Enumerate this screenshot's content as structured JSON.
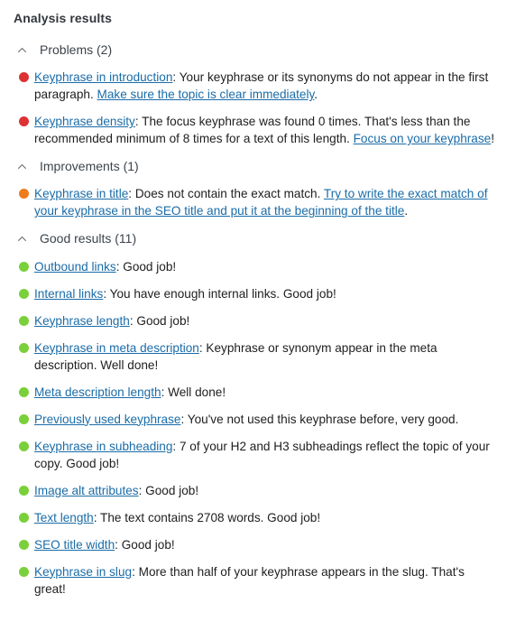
{
  "panel": {
    "title": "Analysis results"
  },
  "colors": {
    "problem": "#dc3232",
    "improvement": "#ee7c1b",
    "good": "#7ad03a",
    "link": "#1a6ca8",
    "heading": "#32373c",
    "section_heading": "#3c434a",
    "body_text": "#1e1e1e",
    "background": "#ffffff"
  },
  "icons": {
    "collapse": "chevron-up-icon"
  },
  "sections": [
    {
      "id": "problems",
      "title": "Problems (2)",
      "count": 2,
      "expanded": true,
      "bullet_color": "#dc3232",
      "items": [
        {
          "name": "keyphrase-in-introduction",
          "parts": [
            {
              "type": "link",
              "text": "Keyphrase in introduction"
            },
            {
              "type": "text",
              "text": ": Your keyphrase or its synonyms do not appear in the first paragraph. "
            },
            {
              "type": "link",
              "text": "Make sure the topic is clear immediately"
            },
            {
              "type": "text",
              "text": "."
            }
          ]
        },
        {
          "name": "keyphrase-density",
          "parts": [
            {
              "type": "link",
              "text": "Keyphrase density"
            },
            {
              "type": "text",
              "text": ": The focus keyphrase was found 0 times. That's less than the recommended minimum of 8 times for a text of this length. "
            },
            {
              "type": "link",
              "text": "Focus on your keyphrase"
            },
            {
              "type": "text",
              "text": "!"
            }
          ]
        }
      ]
    },
    {
      "id": "improvements",
      "title": "Improvements (1)",
      "count": 1,
      "expanded": true,
      "bullet_color": "#ee7c1b",
      "items": [
        {
          "name": "keyphrase-in-title",
          "parts": [
            {
              "type": "link",
              "text": "Keyphrase in title"
            },
            {
              "type": "text",
              "text": ": Does not contain the exact match. "
            },
            {
              "type": "link",
              "text": "Try to write the exact match of your keyphrase in the SEO title and put it at the beginning of the title"
            },
            {
              "type": "text",
              "text": "."
            }
          ]
        }
      ]
    },
    {
      "id": "good-results",
      "title": "Good results (11)",
      "count": 11,
      "expanded": true,
      "bullet_color": "#7ad03a",
      "items": [
        {
          "name": "outbound-links",
          "parts": [
            {
              "type": "link",
              "text": "Outbound links"
            },
            {
              "type": "text",
              "text": ": Good job!"
            }
          ]
        },
        {
          "name": "internal-links",
          "parts": [
            {
              "type": "link",
              "text": "Internal links"
            },
            {
              "type": "text",
              "text": ": You have enough internal links. Good job!"
            }
          ]
        },
        {
          "name": "keyphrase-length",
          "parts": [
            {
              "type": "link",
              "text": "Keyphrase length"
            },
            {
              "type": "text",
              "text": ": Good job!"
            }
          ]
        },
        {
          "name": "keyphrase-in-meta-description",
          "parts": [
            {
              "type": "link",
              "text": "Keyphrase in meta description"
            },
            {
              "type": "text",
              "text": ": Keyphrase or synonym appear in the meta description. Well done!"
            }
          ]
        },
        {
          "name": "meta-description-length",
          "parts": [
            {
              "type": "link",
              "text": "Meta description length"
            },
            {
              "type": "text",
              "text": ": Well done!"
            }
          ]
        },
        {
          "name": "previously-used-keyphrase",
          "parts": [
            {
              "type": "link",
              "text": "Previously used keyphrase"
            },
            {
              "type": "text",
              "text": ": You've not used this keyphrase before, very good."
            }
          ]
        },
        {
          "name": "keyphrase-in-subheading",
          "parts": [
            {
              "type": "link",
              "text": "Keyphrase in subheading"
            },
            {
              "type": "text",
              "text": ": 7 of your H2 and H3 subheadings reflect the topic of your copy. Good job!"
            }
          ]
        },
        {
          "name": "image-alt-attributes",
          "parts": [
            {
              "type": "link",
              "text": "Image alt attributes"
            },
            {
              "type": "text",
              "text": ": Good job!"
            }
          ]
        },
        {
          "name": "text-length",
          "parts": [
            {
              "type": "link",
              "text": "Text length"
            },
            {
              "type": "text",
              "text": ": The text contains 2708 words. Good job!"
            }
          ]
        },
        {
          "name": "seo-title-width",
          "parts": [
            {
              "type": "link",
              "text": "SEO title width"
            },
            {
              "type": "text",
              "text": ": Good job!"
            }
          ]
        },
        {
          "name": "keyphrase-in-slug",
          "parts": [
            {
              "type": "link",
              "text": "Keyphrase in slug"
            },
            {
              "type": "text",
              "text": ": More than half of your keyphrase appears in the slug. That's great!"
            }
          ]
        }
      ]
    }
  ]
}
